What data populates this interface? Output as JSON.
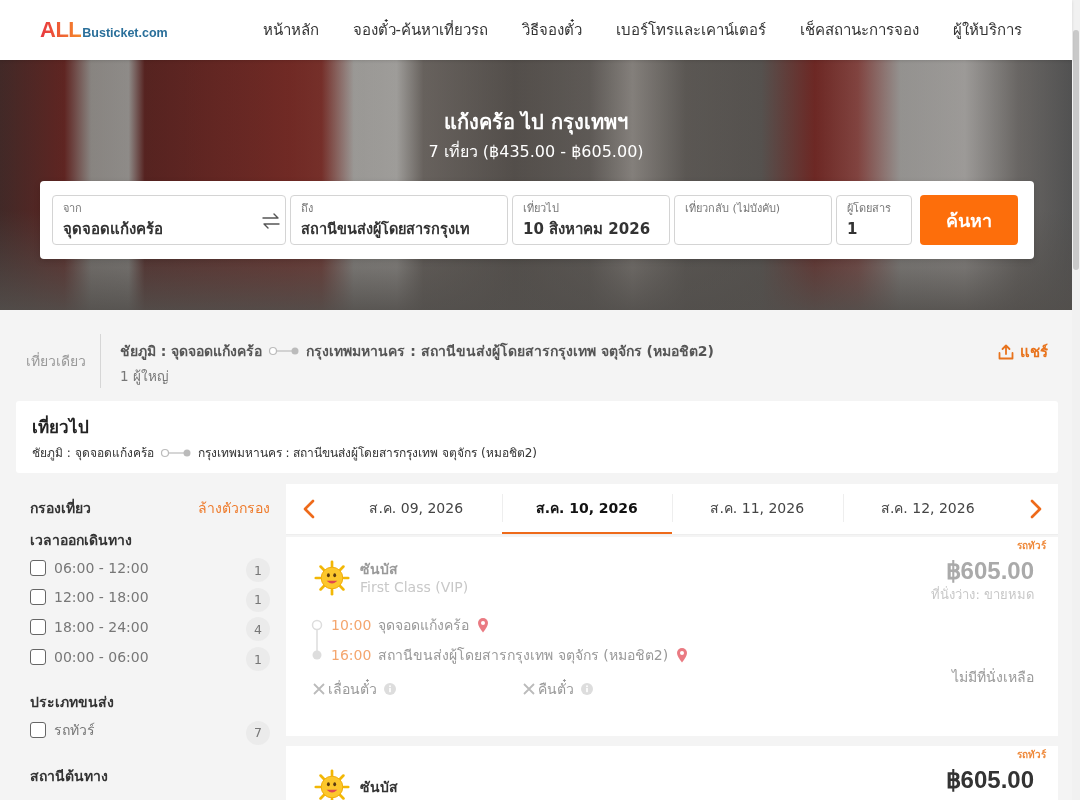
{
  "header": {
    "logo": {
      "brand": "ALL",
      "suffix": "Busticket.com"
    },
    "nav": [
      "หน้าหลัก",
      "จองตั๋ว-ค้นหาเที่ยวรถ",
      "วิธีจองตั๋ว",
      "เบอร์โทรและเคาน์เตอร์",
      "เช็คสถานะการจอง",
      "ผู้ให้บริการ"
    ]
  },
  "hero": {
    "title": "แก้งคร้อ ไป กรุงเทพฯ",
    "subtitle": "7 เที่ยว (฿435.00 - ฿605.00)"
  },
  "search_form": {
    "fields": [
      {
        "kind": "location",
        "label": "จาก",
        "value": "จุดจอดแก้งคร้อ",
        "swap": true
      },
      {
        "kind": "location",
        "label": "ถึง",
        "value": "สถานีขนส่งผู้โดยสารกรุงเท"
      },
      {
        "kind": "date",
        "label": "เที่ยวไป",
        "value": "10 สิงหาคม 2026"
      },
      {
        "kind": "date",
        "label": "เที่ยวกลับ (ไม่บังคับ)"
      },
      {
        "kind": "passengers",
        "label": "ผู้โดยสาร",
        "value": "1"
      }
    ],
    "button": "ค้นหา"
  },
  "trip_summary": {
    "trip_type": "เที่ยวเดียว",
    "origin": "ชัยภูมิ : จุดจอดแก้งคร้อ",
    "destination": "กรุงเทพมหานคร : สถานีขนส่งผู้โดยสารกรุงเทพ จตุจักร (หมอชิต2)",
    "passengers": "1 ผู้ใหญ่",
    "share": "แชร์"
  },
  "outbound": {
    "title": "เที่ยวไป",
    "origin": "ชัยภูมิ : จุดจอดแก้งคร้อ",
    "destination": "กรุงเทพมหานคร : สถานีขนส่งผู้โดยสารกรุงเทพ จตุจักร (หมอชิต2)"
  },
  "filters": {
    "title": "กรองเที่ยว",
    "clear": "ล้างตัวกรอง",
    "groups": [
      {
        "title": "เวลาออกเดินทาง",
        "options": [
          {
            "label": "06:00 - 12:00",
            "count": "1",
            "checked": false
          },
          {
            "label": "12:00 - 18:00",
            "count": "1",
            "checked": false
          },
          {
            "label": "18:00 - 24:00",
            "count": "4",
            "checked": false
          },
          {
            "label": "00:00 - 06:00",
            "count": "1",
            "checked": false
          }
        ]
      },
      {
        "title": "ประเภทขนส่ง",
        "options": [
          {
            "label": "รถทัวร์",
            "count": "7",
            "checked": false
          }
        ]
      },
      {
        "title": "สถานีต้นทาง"
      }
    ]
  },
  "date_tabs": [
    {
      "label": "ส.ค. 09, 2026",
      "selected": false
    },
    {
      "label": "ส.ค. 10, 2026",
      "selected": true
    },
    {
      "label": "ส.ค. 11, 2026",
      "selected": false
    },
    {
      "label": "ส.ค. 12, 2026",
      "selected": false
    }
  ],
  "trips": [
    {
      "tag": "รถทัวร์",
      "operator": "ซันบัส",
      "class": "First Class (VIP)",
      "price": "฿605.00",
      "seats": "ที่นั่งว่าง: ขายหมด",
      "sold_out": true,
      "stops": [
        {
          "time": "10:00",
          "place": "จุดจอดแก้งคร้อ"
        },
        {
          "time": "16:00",
          "place": "สถานีขนส่งผู้โดยสารกรุงเทพ จตุจักร (หมอชิต2)"
        }
      ],
      "policies": [
        {
          "label": "เลื่อนตั๋ว",
          "allowed": false
        },
        {
          "label": "คืนตั๋ว",
          "allowed": false
        }
      ],
      "availability": "ไม่มีที่นั่งเหลือ"
    },
    {
      "tag": "รถทัวร์",
      "operator": "ซันบัส",
      "price": "฿605.00",
      "sold_out": false
    }
  ]
}
